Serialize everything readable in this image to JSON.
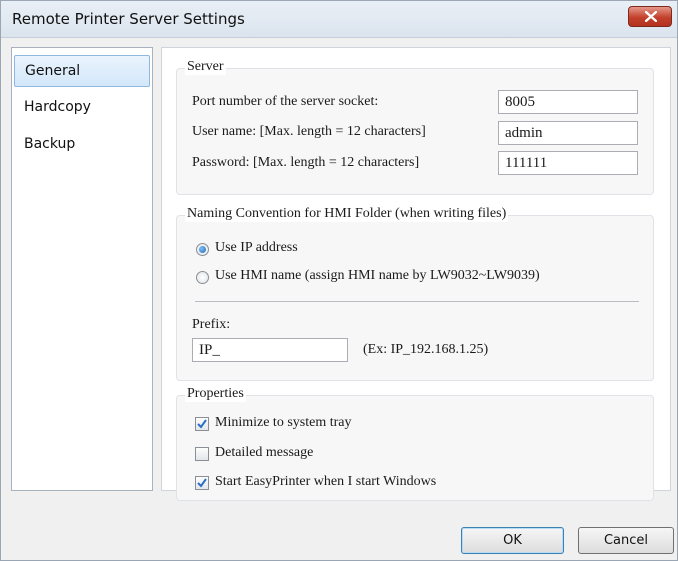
{
  "window": {
    "title": "Remote Printer Server Settings"
  },
  "sidebar": {
    "items": [
      {
        "label": "General",
        "selected": true
      },
      {
        "label": "Hardcopy",
        "selected": false
      },
      {
        "label": "Backup",
        "selected": false
      }
    ]
  },
  "server": {
    "title": "Server",
    "port_label": "Port number of the server socket:",
    "port_value": "8005",
    "user_label": "User name: [Max. length = 12 characters]",
    "user_value": "admin",
    "password_label": "Password: [Max. length = 12 characters]",
    "password_value": "111111"
  },
  "naming": {
    "title": "Naming Convention for HMI Folder (when writing files)",
    "option_ip": "Use IP address",
    "option_hmi": "Use HMI name (assign HMI name by LW9032~LW9039)",
    "selected": "ip",
    "prefix_label": "Prefix:",
    "prefix_value": "IP_",
    "prefix_example": "(Ex: IP_192.168.1.25)"
  },
  "properties": {
    "title": "Properties",
    "minimize_label": "Minimize to system tray",
    "minimize_checked": true,
    "detailed_label": "Detailed message",
    "detailed_checked": false,
    "startup_label": "Start EasyPrinter when I start Windows",
    "startup_checked": true
  },
  "buttons": {
    "ok": "OK",
    "cancel": "Cancel"
  },
  "colors": {
    "check": "#2a6fc4",
    "close_button": "#c3412c"
  }
}
